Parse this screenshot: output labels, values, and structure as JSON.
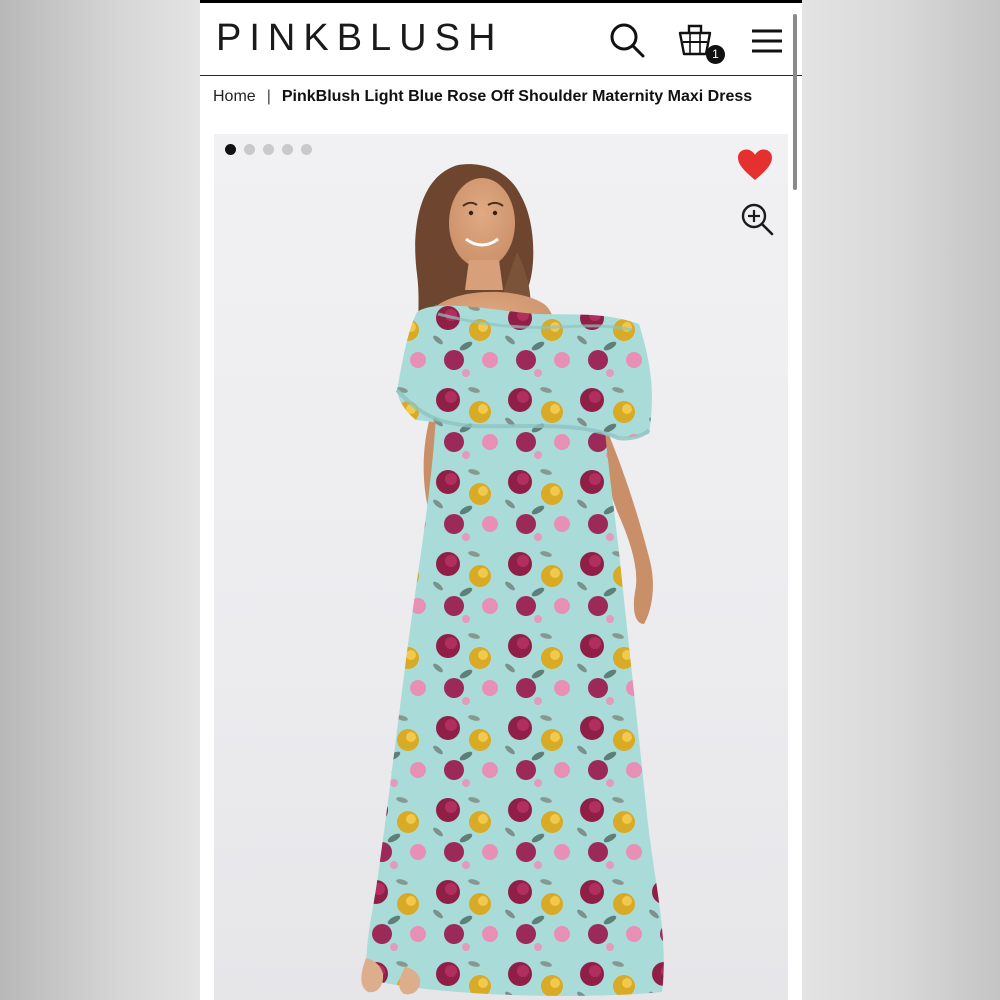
{
  "header": {
    "logo": "PINKBLUSH",
    "icons": {
      "search": "search-icon",
      "bag": "shopping-bag-icon",
      "menu": "hamburger-menu-icon"
    },
    "bag_count": "1"
  },
  "breadcrumb": {
    "home": "Home",
    "separator": "|",
    "current": "PinkBlush Light Blue Rose Off Shoulder Maternity Maxi Dress"
  },
  "gallery": {
    "slide_count": 5,
    "active_slide": 1,
    "favorite_icon": "heart-icon",
    "zoom_icon": "zoom-in-icon",
    "image_subject": "model wearing light blue floral off-shoulder maxi dress"
  },
  "colors": {
    "heart": "#e4312f",
    "dress_base": "#a9dcd9",
    "rose": "#8f1f47",
    "yellow_flower": "#d8aa26"
  }
}
